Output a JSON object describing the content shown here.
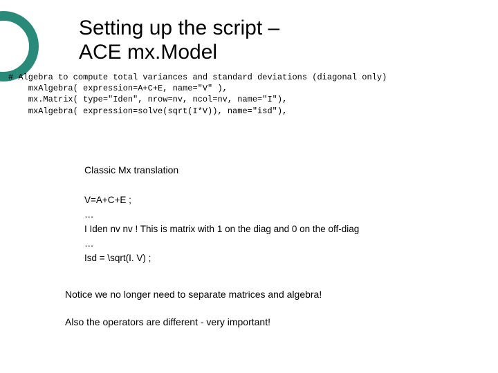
{
  "title": {
    "line1": "Setting up the script –",
    "line2": "ACE mx.Model"
  },
  "code": {
    "comment": "# Algebra to compute total variances and standard deviations (diagonal only)",
    "l1": "    mxAlgebra( expression=A+C+E, name=\"V\" ),",
    "l2": "    mx.Matrix( type=\"Iden\", nrow=nv, ncol=nv, name=\"I\"),",
    "l3": "    mxAlgebra( expression=solve(sqrt(I*V)), name=\"isd\"),"
  },
  "classic": {
    "heading": "Classic Mx translation",
    "l1": "V=A+C+E ;",
    "l2": "…",
    "l3": "I Iden nv nv ! This is matrix with 1 on the diag and 0 on the off-diag",
    "l4": "…",
    "l5": "Isd = \\sqrt(I. V) ;"
  },
  "notes": {
    "n1": "Notice we no longer need to separate matrices and algebra!",
    "n2": "Also the operators are different - very important!"
  },
  "colors": {
    "ring": "#2a8a7a"
  }
}
